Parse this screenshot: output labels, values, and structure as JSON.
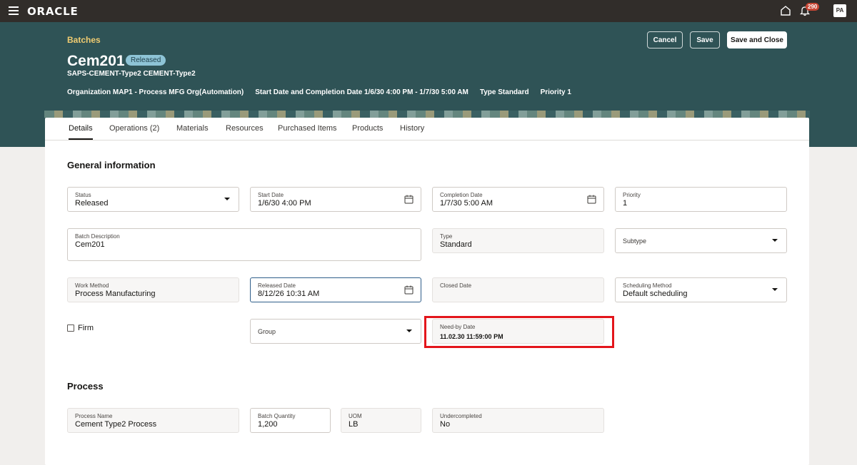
{
  "app": {
    "logo": "ORACLE",
    "notification_count": "290",
    "avatar_initials": "PA"
  },
  "header": {
    "breadcrumb": "Batches",
    "title": "Cem201",
    "status": "Released",
    "subtitle": "SAPS-CEMENT-Type2 CEMENT-Type2",
    "meta": [
      "Organization MAP1 - Process MFG Org(Automation)",
      "Start Date and Completion Date 1/6/30 4:00 PM - 1/7/30 5:00 AM",
      "Type Standard",
      "Priority 1"
    ],
    "buttons": {
      "cancel": "Cancel",
      "save": "Save",
      "save_close": "Save and Close"
    }
  },
  "tabs": [
    "Details",
    "Operations (2)",
    "Materials",
    "Resources",
    "Purchased Items",
    "Products",
    "History"
  ],
  "general": {
    "title": "General information",
    "status": {
      "label": "Status",
      "value": "Released"
    },
    "start_date": {
      "label": "Start Date",
      "value": "1/6/30 4:00 PM"
    },
    "completion_date": {
      "label": "Completion Date",
      "value": "1/7/30 5:00 AM"
    },
    "priority": {
      "label": "Priority",
      "value": "1"
    },
    "batch_description": {
      "label": "Batch Description",
      "value": "Cem201"
    },
    "type": {
      "label": "Type",
      "value": "Standard"
    },
    "subtype": {
      "label": "Subtype"
    },
    "work_method": {
      "label": "Work Method",
      "value": "Process Manufacturing"
    },
    "released_date": {
      "label": "Released Date",
      "value": "8/12/26 10:31 AM"
    },
    "closed_date": {
      "label": "Closed Date"
    },
    "scheduling_method": {
      "label": "Scheduling Method",
      "value": "Default scheduling"
    },
    "firm": {
      "label": "Firm"
    },
    "group": {
      "label": "Group"
    },
    "need_by_date": {
      "label": "Need-by Date",
      "value": "11.02.30 11:59:00 PM"
    }
  },
  "process": {
    "title": "Process",
    "process_name": {
      "label": "Process Name",
      "value": "Cement Type2 Process"
    },
    "batch_quantity": {
      "label": "Batch Quantity",
      "value": "1,200"
    },
    "uom": {
      "label": "UOM",
      "value": "LB"
    },
    "undercompleted": {
      "label": "Undercompleted",
      "value": "No"
    }
  }
}
